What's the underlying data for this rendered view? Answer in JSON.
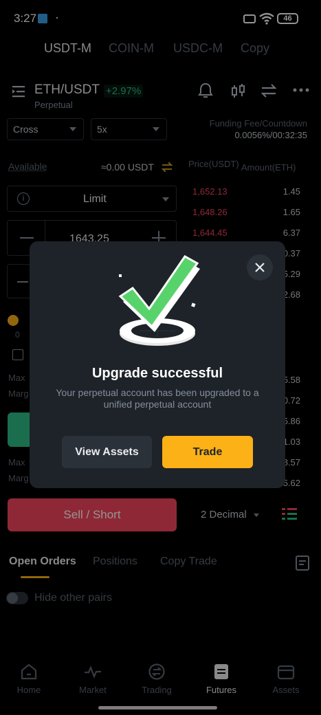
{
  "status": {
    "time": "3:27",
    "dot": "·",
    "battery": "46"
  },
  "top_tabs": [
    "USDT-M",
    "COIN-M",
    "USDC-M",
    "Copy"
  ],
  "pair": {
    "symbol": "ETH/USDT",
    "change": "+2.97%",
    "type": "Perpetual"
  },
  "controls": {
    "margin_mode": "Cross",
    "leverage": "5x"
  },
  "funding": {
    "label": "Funding Fee/Countdown",
    "value": "0.0056%/00:32:35"
  },
  "available": {
    "label": "Available",
    "value": "≈0.00 USDT"
  },
  "order_type": "Limit",
  "price_input": "1643.25",
  "orderbook": {
    "price_header": "Price(USDT)",
    "amount_header": "Amount(ETH)",
    "asks": [
      {
        "price": "1,652.13",
        "amount": "1.45"
      },
      {
        "price": "1,648.26",
        "amount": "1.65"
      },
      {
        "price": "1,644.45",
        "amount": "6.37"
      }
    ],
    "partial_amounts": [
      "0.37",
      "5.29",
      "2.68",
      "5.58",
      "0.72",
      "5.86",
      "1.03",
      "8.57",
      "5.62"
    ]
  },
  "left_partial": {
    "zero": "0",
    "max1": "Max",
    "marg1": "Marg",
    "max2": "Max",
    "marg2": "Marg"
  },
  "sell_button": "Sell / Short",
  "decimal_select": "2 Decimal",
  "bottom_tabs": [
    "Open Orders",
    "Positions",
    "Copy Trade"
  ],
  "hide_pairs": "Hide other pairs",
  "nav": [
    "Home",
    "Market",
    "Trading",
    "Futures",
    "Assets"
  ],
  "modal": {
    "title": "Upgrade successful",
    "message": "Your perpetual account has been upgraded to a unified perpetual account",
    "btn_secondary": "View Assets",
    "btn_primary": "Trade"
  },
  "colors": {
    "accent": "#fcb116",
    "green": "#2ebd85",
    "red": "#f6465d",
    "modal_bg": "#1e2329"
  }
}
